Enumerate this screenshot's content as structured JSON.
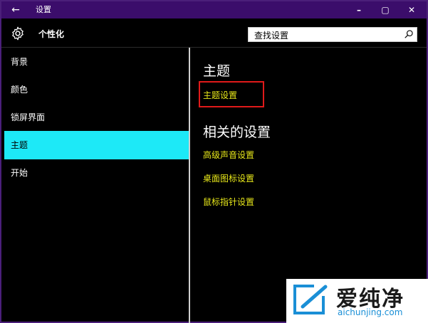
{
  "window": {
    "title": "设置",
    "back_glyph": "←",
    "minimize_glyph": "–",
    "maximize_glyph": "▢",
    "close_glyph": "✕"
  },
  "header": {
    "title": "个性化",
    "icon": "gear-icon",
    "search": {
      "value": "查找设置",
      "icon": "search-icon"
    }
  },
  "sidebar": {
    "items": [
      {
        "label": "背景",
        "active": false
      },
      {
        "label": "颜色",
        "active": false
      },
      {
        "label": "锁屏界面",
        "active": false
      },
      {
        "label": "主题",
        "active": true
      },
      {
        "label": "开始",
        "active": false
      }
    ]
  },
  "content": {
    "section_title": "主题",
    "theme_link": "主题设置",
    "related_title": "相关的设置",
    "related_links": [
      "高级声音设置",
      "桌面图标设置",
      "鼠标指针设置"
    ]
  },
  "watermark": {
    "text_cn": "爱纯净",
    "text_en": "aichunjing.com"
  },
  "colors": {
    "titlebar": "#3b0d6b",
    "accent_active": "#1de9f7",
    "link": "#e8e81a",
    "highlight": "#e01a1a"
  }
}
